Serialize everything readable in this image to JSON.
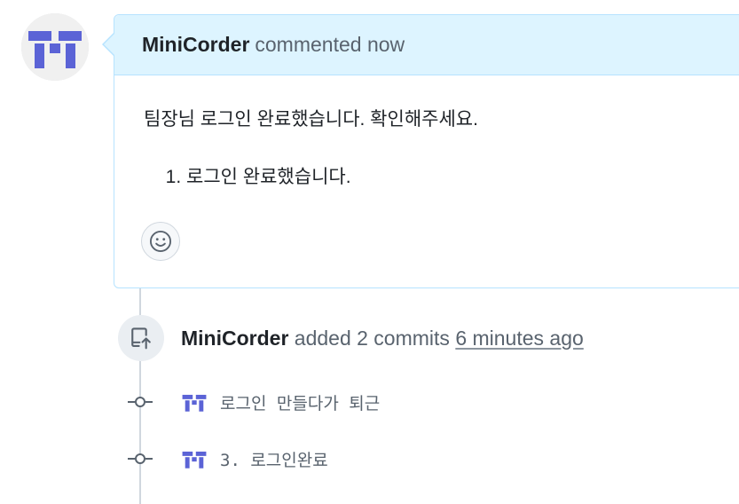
{
  "colors": {
    "header_background": "#ddf4ff",
    "border_blue": "#b6e3ff",
    "avatar_purple": "#5b63d6",
    "muted_text": "#59636e",
    "timeline": "#d0d7de"
  },
  "comment": {
    "author": "MiniCorder",
    "action": "commented now",
    "body_paragraph": "팀장님 로그인 완료했습니다. 확인해주세요.",
    "list_items": [
      "로그인 완료했습니다."
    ],
    "reaction_icon": "smiley-icon"
  },
  "event": {
    "icon": "push-icon",
    "author": "MiniCorder",
    "action": "added 2 commits",
    "time": "6 minutes ago"
  },
  "commits": [
    {
      "message": "로그인 만들다가 퇴근",
      "icon": "git-commit-icon"
    },
    {
      "message": "3. 로그인완료",
      "icon": "git-commit-icon"
    }
  ]
}
